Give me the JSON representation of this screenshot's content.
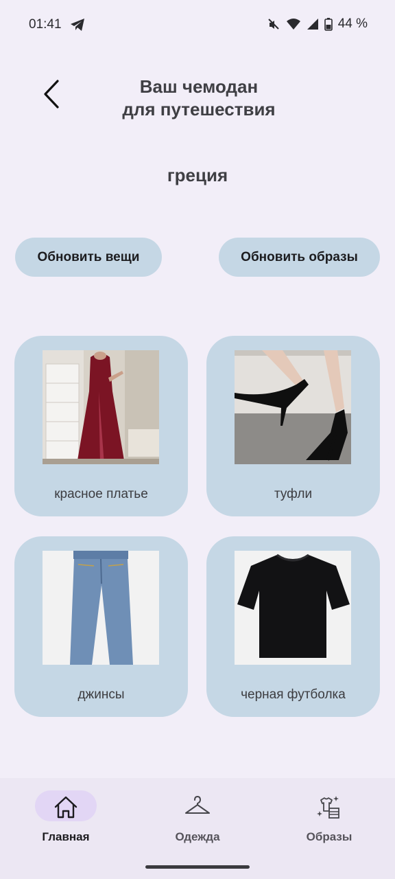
{
  "status_bar": {
    "time": "01:41",
    "battery": "44 %"
  },
  "header": {
    "title_line1": "Ваш чемодан",
    "title_line2": "для путешествия"
  },
  "trip_name": "греция",
  "actions": {
    "update_items": "Обновить вещи",
    "update_outfits": "Обновить образы"
  },
  "items": [
    {
      "label": "красное платье",
      "icon": "dress-photo"
    },
    {
      "label": "туфли",
      "icon": "heels-photo"
    },
    {
      "label": "джинсы",
      "icon": "jeans-photo"
    },
    {
      "label": "черная футболка",
      "icon": "tshirt-photo"
    }
  ],
  "nav": [
    {
      "label": "Главная",
      "icon": "home-icon",
      "active": true
    },
    {
      "label": "Одежда",
      "icon": "hanger-icon",
      "active": false
    },
    {
      "label": "Образы",
      "icon": "outfits-icon",
      "active": false
    }
  ],
  "colors": {
    "background": "#f2eef8",
    "card": "#c5d7e5",
    "nav_active": "#e2d6f5"
  }
}
